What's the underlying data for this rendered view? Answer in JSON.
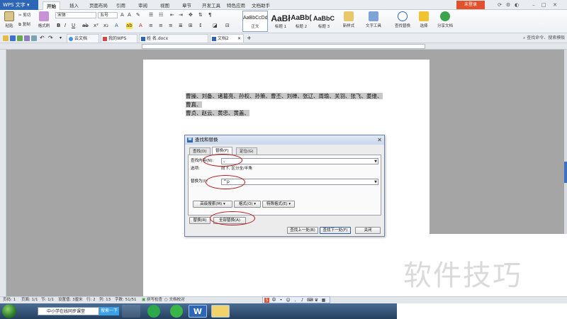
{
  "menubar": {
    "app_name": "WPS 文字",
    "tabs": [
      "开始",
      "插入",
      "页面布局",
      "引用",
      "审阅",
      "视图",
      "章节",
      "开发工具",
      "特色应用",
      "文档助手"
    ],
    "active_tab": "开始",
    "login_label": "未登录"
  },
  "ribbon": {
    "paste_label": "粘贴",
    "cut_label": "剪切",
    "copy_label": "复制",
    "format_painter_label": "格式刷",
    "font_name": "宋体",
    "font_size": "五号",
    "styles": [
      {
        "sample": "AaBbCcDd",
        "name": "正文"
      },
      {
        "sample": "AaBł",
        "name": "标题 1"
      },
      {
        "sample": "AaBb(",
        "name": "标题 2"
      },
      {
        "sample": "AaBbC",
        "name": "标题 3"
      }
    ],
    "new_style_label": "新样式",
    "text_tools_label": "文字工具",
    "find_replace_label": "查找替换",
    "select_label": "选择",
    "share_label": "分享文档"
  },
  "tabs_bar": {
    "doc_tabs": [
      "云文档",
      "我的WPS",
      "姓  名.docx",
      "文档2"
    ],
    "active_doc": "文档2",
    "command_search": "查找命令、搜索模板"
  },
  "document": {
    "text_line1": "曹操、刘备、诸葛亮、孙权、孙策、曹丕、刘禅、张辽、周瑜、关羽、张飞、姜维、曹真、",
    "text_line2": "曹贞、赵云、黄忠、黄盖、"
  },
  "dialog": {
    "title": "查找和替换",
    "tabs": [
      "查找(D)",
      "替换(P)",
      "定位(G)"
    ],
    "active_tab": "替换(P)",
    "find_label": "查找内容(N):",
    "find_value": "、",
    "options_label": "选项:",
    "options_value": "向下, 区分全/半角",
    "replace_label": "替换为(I):",
    "replace_value": "^p",
    "advanced_search": "高级搜索(M) ▾",
    "format_btn": "格式(O) ▾",
    "special_format_btn": "特殊格式(E) ▾",
    "replace_btn": "替换(R)",
    "replace_all_btn": "全部替换(A)",
    "find_prev_btn": "查找上一处(B)",
    "find_next_btn": "查找下一处(F)",
    "close_btn": "关闭"
  },
  "statusbar": {
    "page_num": "页码: 1",
    "pages": "页面: 1/1",
    "section": "节: 1/1",
    "setting": "设置值: 3厘米",
    "row": "行: 2",
    "col": "列: 13",
    "words": "字数: 51/51",
    "spell": "拼写检查",
    "proof": "文档校对"
  },
  "taskbar": {
    "search_text": "中小学在线同步课堂",
    "search_btn": "搜索一下"
  },
  "watermark": "软件技巧",
  "colors": {
    "accent": "#2d66b5",
    "login_button": "#e2502c",
    "annotation_oval": "#b2171c",
    "selection": "#c8c8c8"
  }
}
